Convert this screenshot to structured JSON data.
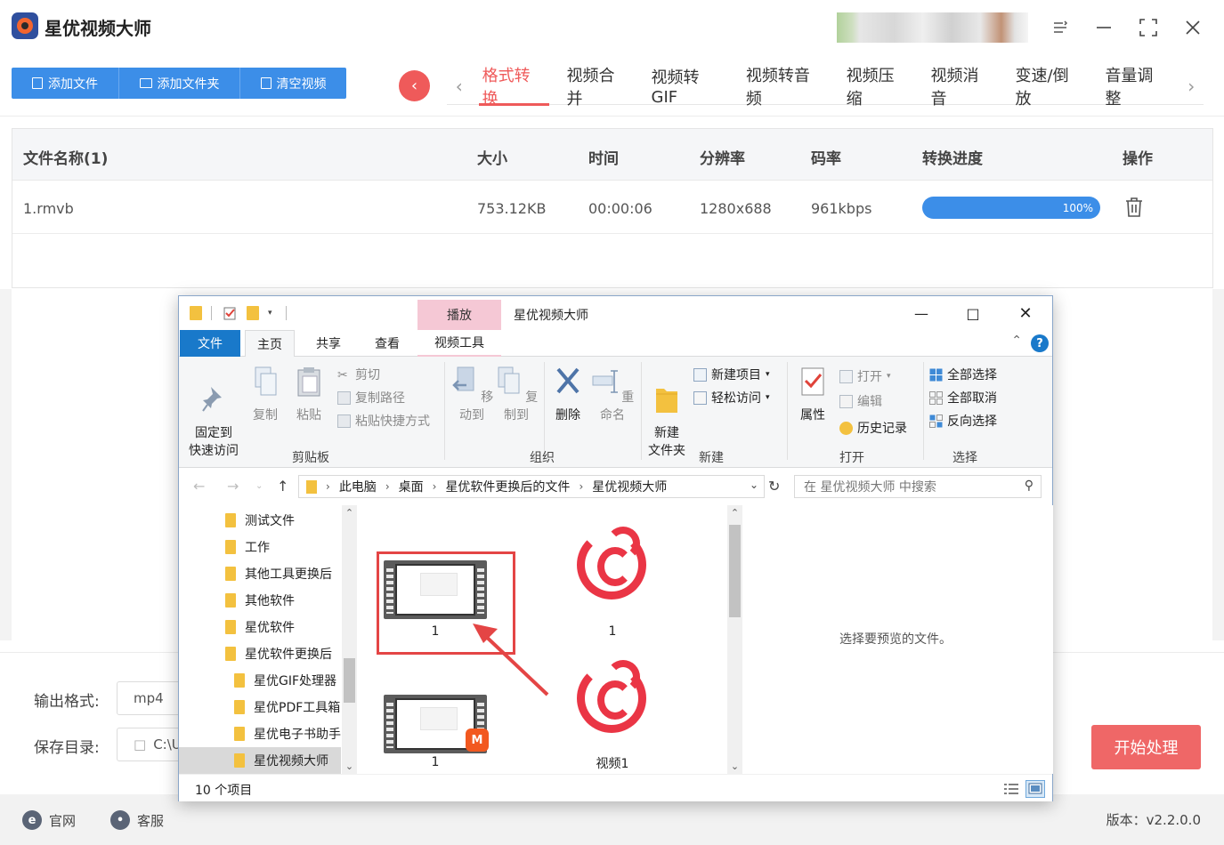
{
  "app": {
    "title": "星优视频大师",
    "colors": {
      "accent_blue": "#3c8ee8",
      "accent_red": "#ef5a5a",
      "start_btn": "#ef6767"
    }
  },
  "toolbar": {
    "add_file": "添加文件",
    "add_folder": "添加文件夹",
    "clear_video": "清空视频"
  },
  "tabs": [
    "格式转换",
    "视频合并",
    "视频转GIF",
    "视频转音频",
    "视频压缩",
    "视频消音",
    "变速/倒放",
    "音量调整"
  ],
  "active_tab": "格式转换",
  "table": {
    "headers": [
      "文件名称(1)",
      "大小",
      "时间",
      "分辨率",
      "码率",
      "转换进度",
      "操作"
    ],
    "rows": [
      {
        "name": "1.rmvb",
        "size": "753.12KB",
        "time": "00:00:06",
        "resolution": "1280x688",
        "bitrate": "961kbps",
        "progress": 1.0,
        "progress_label": "100%"
      }
    ]
  },
  "output": {
    "format_label": "输出格式:",
    "format_value": "mp4",
    "dir_label": "保存目录:",
    "dir_value": "C:\\U"
  },
  "start_button": "开始处理",
  "footer": {
    "website": "官网",
    "support": "客服",
    "version": "版本：v2.2.0.0"
  },
  "explorer": {
    "context_tab": "播放",
    "title": "星优视频大师",
    "ribbon_tabs": {
      "file": "文件",
      "home": "主页",
      "share": "共享",
      "view": "查看",
      "video_tools": "视频工具"
    },
    "clipboard": {
      "pin": "固定到\n快速访问",
      "copy": "复制",
      "paste": "粘贴",
      "cut": "剪切",
      "copy_path": "复制路径",
      "paste_shortcut": "粘贴快捷方式",
      "label": "剪贴板"
    },
    "organize": {
      "move_to": "移动到",
      "copy_to": "复制到",
      "delete": "删除",
      "rename": "重命名",
      "label": "组织"
    },
    "new": {
      "new_folder": "新建\n文件夹",
      "new_item": "新建项目",
      "easy_access": "轻松访问",
      "label": "新建"
    },
    "open": {
      "properties": "属性",
      "open": "打开",
      "edit": "编辑",
      "history": "历史记录",
      "label": "打开"
    },
    "select": {
      "select_all": "全部选择",
      "select_none": "全部取消",
      "invert": "反向选择",
      "label": "选择"
    },
    "breadcrumb": [
      "此电脑",
      "桌面",
      "星优软件更换后的文件",
      "星优视频大师"
    ],
    "search_placeholder": "在 星优视频大师 中搜索",
    "tree": [
      "测试文件",
      "工作",
      "其他工具更换后",
      "其他软件",
      "星优软件",
      "星优软件更换后",
      "星优GIF处理器",
      "星优PDF工具箱",
      "星优电子书助手",
      "星优视频大师"
    ],
    "files": [
      {
        "name": "1",
        "icon": "video-thumbnail-icon"
      },
      {
        "name": "1",
        "icon": "netease-music-icon"
      },
      {
        "name": "1",
        "icon": "video-thumbnail-icon"
      },
      {
        "name": "视频1",
        "icon": "netease-music-icon"
      }
    ],
    "preview_text": "选择要预览的文件。",
    "status": "10 个项目"
  }
}
